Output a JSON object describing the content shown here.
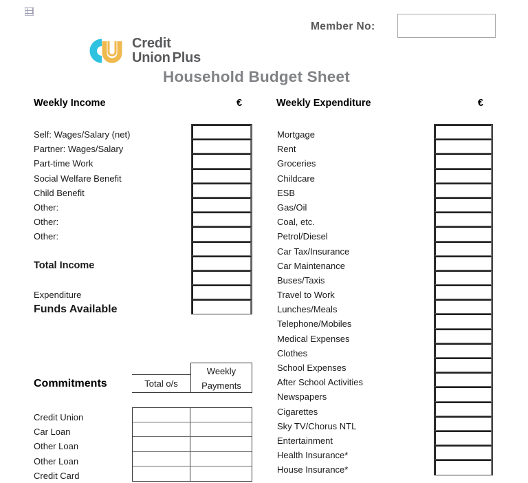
{
  "document": {
    "title": "Household Budget Sheet",
    "table_handle_icon": "table-move-handle-icon"
  },
  "header": {
    "member_label": "Member No:",
    "member_value": "",
    "member_placeholder": ""
  },
  "logo": {
    "mark_icon": "cu-monogram-icon",
    "line1": "Credit",
    "line2": "Union",
    "line2b": "Plus",
    "colors": {
      "c_cyan": "#2ec2e0",
      "u_gold": "#f0b94e",
      "text_grey": "#58595b",
      "title_grey": "#808285"
    }
  },
  "columns": {
    "income_heading": "Weekly Income",
    "income_currency": "€",
    "expenditure_heading": "Weekly Expenditure",
    "expenditure_currency": "€"
  },
  "income": {
    "rows": [
      {
        "label": "Self: Wages/Salary (net)",
        "style": "normal"
      },
      {
        "label": "Partner: Wages/Salary",
        "style": "normal"
      },
      {
        "label": "Part-time Work",
        "style": "normal"
      },
      {
        "label": "Social Welfare Benefit",
        "style": "normal"
      },
      {
        "label": "Child Benefit",
        "style": "normal"
      },
      {
        "label": "Other:",
        "style": "normal"
      },
      {
        "label": "Other:",
        "style": "normal"
      },
      {
        "label": "Other:",
        "style": "normal"
      },
      {
        "label": "",
        "style": "blank"
      },
      {
        "label": "Total Income",
        "style": "bold"
      },
      {
        "label": "",
        "style": "blank"
      },
      {
        "label": "Expenditure",
        "style": "normal"
      },
      {
        "label": "Funds Available",
        "style": "big"
      }
    ],
    "box_values": [
      "",
      "",
      "",
      "",
      "",
      "",
      "",
      "",
      "",
      "",
      "",
      "",
      ""
    ]
  },
  "expenditure": {
    "rows": [
      "Mortgage",
      "Rent",
      "Groceries",
      "Childcare",
      "ESB",
      "Gas/Oil",
      "Coal, etc.",
      "Petrol/Diesel",
      "Car Tax/Insurance",
      "Car Maintenance",
      "Buses/Taxis",
      "Travel to Work",
      "Lunches/Meals",
      "Telephone/Mobiles",
      "Medical Expenses",
      "Clothes",
      "School Expenses",
      "After School Activities",
      "Newspapers",
      "Cigarettes",
      "Sky TV/Chorus NTL",
      "Entertainment",
      "Health Insurance*",
      "House Insurance*"
    ],
    "box_values": [
      "",
      "",
      "",
      "",
      "",
      "",
      "",
      "",
      "",
      "",
      "",
      "",
      "",
      "",
      "",
      "",
      "",
      "",
      "",
      "",
      "",
      "",
      "",
      ""
    ]
  },
  "commitments": {
    "title": "Commitments",
    "col_total_label": "Total o/s",
    "col_weekly_label_line1": "Weekly",
    "col_weekly_label_line2": "Payments",
    "rows": [
      {
        "label": "Credit Union",
        "total": "",
        "weekly": ""
      },
      {
        "label": "Car Loan",
        "total": "",
        "weekly": ""
      },
      {
        "label": "Other Loan",
        "total": "",
        "weekly": ""
      },
      {
        "label": "Other Loan",
        "total": "",
        "weekly": ""
      },
      {
        "label": "Credit Card",
        "total": "",
        "weekly": ""
      }
    ]
  }
}
